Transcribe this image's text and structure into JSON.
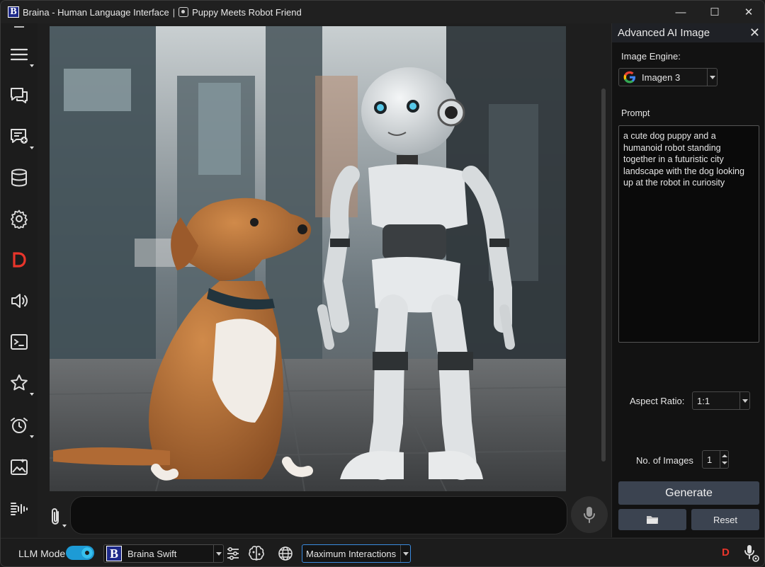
{
  "window": {
    "app_title": "Braina - Human Language Interface",
    "separator": "|",
    "doc_title": "Puppy Meets Robot Friend",
    "app_logo_letter": "B",
    "controls": {
      "minimize": "—",
      "maximize": "☐",
      "close": "✕"
    }
  },
  "sidebar": {
    "items": [
      {
        "icon": "menu-icon"
      },
      {
        "icon": "chat-icon"
      },
      {
        "icon": "new-chat-icon"
      },
      {
        "icon": "database-icon"
      },
      {
        "icon": "gear-icon"
      },
      {
        "icon": "d-logo-icon"
      },
      {
        "icon": "speaker-icon"
      },
      {
        "icon": "terminal-icon"
      },
      {
        "icon": "star-icon"
      },
      {
        "icon": "alarm-icon"
      },
      {
        "icon": "image-gen-icon"
      },
      {
        "icon": "voice-wave-icon"
      }
    ]
  },
  "main": {
    "image_alt": "puppy and robot image",
    "chat_input_value": ""
  },
  "panel": {
    "title": "Advanced AI Image",
    "close": "✕",
    "engine_label": "Image Engine:",
    "engine_value": "Imagen 3",
    "prompt_label": "Prompt",
    "prompt_text": "a cute dog puppy and a\nhumanoid robot standing\ntogether in a futuristic city\nlandscape with the dog looking\nup at the robot in curiosity",
    "aspect_label": "Aspect Ratio:",
    "aspect_value": "1:1",
    "num_images_label": "No. of Images",
    "num_images_value": "1",
    "generate_label": "Generate",
    "reset_label": "Reset"
  },
  "bottombar": {
    "llm_mode_label": "LLM Mode",
    "llm_mode_on": true,
    "model_logo_letter": "B",
    "model_value": "Braina Swift",
    "mode_value": "Maximum Interactions",
    "d_logo": "D"
  },
  "colors": {
    "accent": "#1d9bd6",
    "brand_red": "#e8352b",
    "brand_blue": "#1e2a8a",
    "button": "#3b4350"
  }
}
